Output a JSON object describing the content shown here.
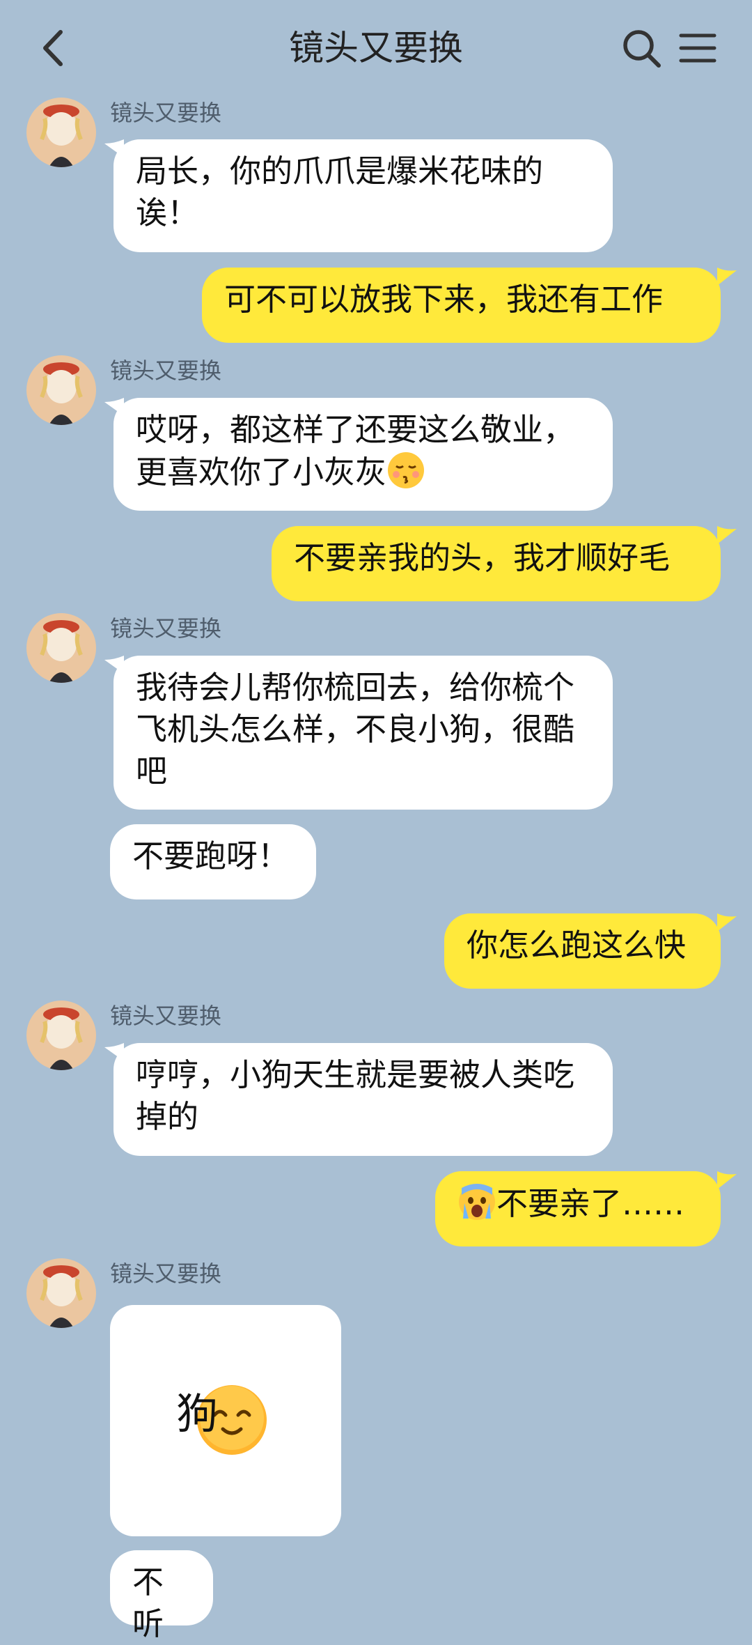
{
  "header": {
    "title": "镜头又要换"
  },
  "icons": {
    "back": "back-arrow-icon",
    "search": "search-icon",
    "menu": "menu-icon"
  },
  "colors": {
    "background": "#a9bfd3",
    "incoming_bubble": "#ffffff",
    "outgoing_bubble": "#ffe93b"
  },
  "messages": [
    {
      "side": "left",
      "sender": "镜头又要换",
      "text": "局长，你的爪爪是爆米花味的诶！"
    },
    {
      "side": "right",
      "text": "可不可以放我下来，我还有工作"
    },
    {
      "side": "left",
      "sender": "镜头又要换",
      "text": "哎呀，都这样了还要这么敬业，更喜欢你了小灰灰",
      "emoji": "kissing-face-emoji"
    },
    {
      "side": "right",
      "text": "不要亲我的头，我才顺好毛"
    },
    {
      "side": "left",
      "sender": "镜头又要换",
      "text": "我待会儿帮你梳回去，给你梳个飞机头怎么样，不良小狗，很酷吧"
    },
    {
      "side": "left",
      "text": "不要跑呀！"
    },
    {
      "side": "right",
      "text": "你怎么跑这么快"
    },
    {
      "side": "left",
      "sender": "镜头又要换",
      "text": "哼哼，小狗天生就是要被人类吃掉的"
    },
    {
      "side": "right",
      "text": "不要亲了……",
      "emoji": "crying-face-emoji"
    },
    {
      "side": "left",
      "sender": "镜头又要换",
      "sticker": "狗",
      "sticker_emoji": "smiling-face-sticker"
    },
    {
      "side": "left",
      "text": "不听"
    }
  ]
}
